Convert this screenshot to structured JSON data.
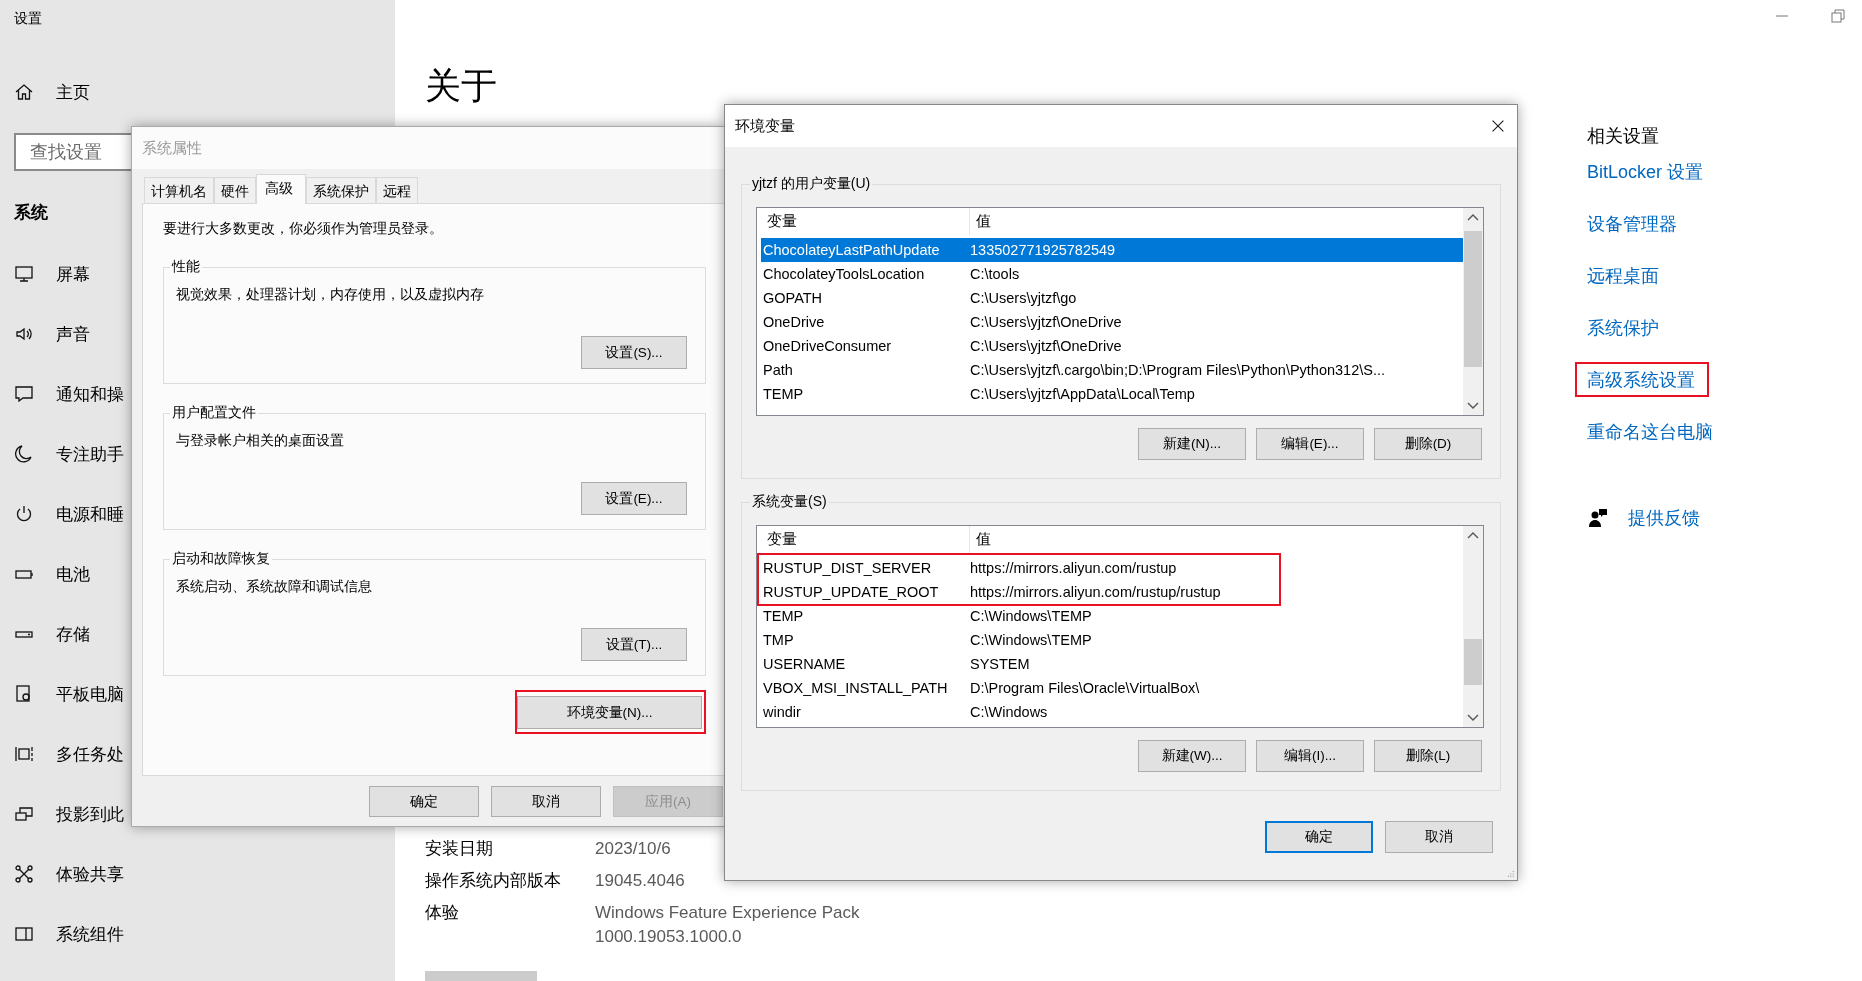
{
  "window": {
    "title": "设置"
  },
  "sidebar": {
    "home": "主页",
    "search": {
      "placeholder": "查找设置"
    },
    "section": "系统",
    "items": [
      {
        "label": "屏幕"
      },
      {
        "label": "声音"
      },
      {
        "label": "通知和操"
      },
      {
        "label": "专注助手"
      },
      {
        "label": "电源和睡"
      },
      {
        "label": "电池"
      },
      {
        "label": "存储"
      },
      {
        "label": "平板电脑"
      },
      {
        "label": "多任务处"
      },
      {
        "label": "投影到此"
      },
      {
        "label": "体验共享"
      },
      {
        "label": "系统组件"
      }
    ]
  },
  "main": {
    "title": "关于",
    "specs": [
      {
        "label": "安装日期",
        "value": "2023/10/6"
      },
      {
        "label": "操作系统内部版本",
        "value": "19045.4046"
      },
      {
        "label": "体验",
        "value": "Windows Feature Experience Pack 1000.19053.1000.0"
      }
    ]
  },
  "related": {
    "title": "相关设置",
    "links": [
      {
        "label": "BitLocker 设置",
        "highlighted": false
      },
      {
        "label": "设备管理器",
        "highlighted": false
      },
      {
        "label": "远程桌面",
        "highlighted": false
      },
      {
        "label": "系统保护",
        "highlighted": false
      },
      {
        "label": "高级系统设置",
        "highlighted": true
      },
      {
        "label": "重命名这台电脑",
        "highlighted": false
      }
    ],
    "feedback": "提供反馈"
  },
  "system_properties": {
    "title": "系统属性",
    "tabs": [
      {
        "label": "计算机名",
        "selected": false
      },
      {
        "label": "硬件",
        "selected": false
      },
      {
        "label": "高级",
        "selected": true
      },
      {
        "label": "系统保护",
        "selected": false
      },
      {
        "label": "远程",
        "selected": false
      }
    ],
    "notice": "要进行大多数更改，你必须作为管理员登录。",
    "groups": [
      {
        "title": "性能",
        "description": "视觉效果，处理器计划，内存使用，以及虚拟内存",
        "button": "设置(S)..."
      },
      {
        "title": "用户配置文件",
        "description": "与登录帐户相关的桌面设置",
        "button": "设置(E)..."
      },
      {
        "title": "启动和故障恢复",
        "description": "系统启动、系统故障和调试信息",
        "button": "设置(T)..."
      }
    ],
    "env_button": {
      "label": "环境变量(N)...",
      "highlighted": true
    },
    "buttons": [
      {
        "label": "确定",
        "disabled": false
      },
      {
        "label": "取消",
        "disabled": false
      },
      {
        "label": "应用(A)",
        "disabled": true
      }
    ]
  },
  "environment": {
    "title": "环境变量",
    "sections": [
      {
        "title": "yjtzf 的用户变量(U)",
        "columns": [
          "变量",
          "值"
        ],
        "rows": [
          {
            "name": "ChocolateyLastPathUpdate",
            "value": "133502771925782549",
            "selected": true,
            "highlighted": false
          },
          {
            "name": "ChocolateyToolsLocation",
            "value": "C:\\tools",
            "selected": false,
            "highlighted": false
          },
          {
            "name": "GOPATH",
            "value": "C:\\Users\\yjtzf\\go",
            "selected": false,
            "highlighted": false
          },
          {
            "name": "OneDrive",
            "value": "C:\\Users\\yjtzf\\OneDrive",
            "selected": false,
            "highlighted": false
          },
          {
            "name": "OneDriveConsumer",
            "value": "C:\\Users\\yjtzf\\OneDrive",
            "selected": false,
            "highlighted": false
          },
          {
            "name": "Path",
            "value": "C:\\Users\\yjtzf\\.cargo\\bin;D:\\Program Files\\Python\\Python312\\S...",
            "selected": false,
            "highlighted": false
          },
          {
            "name": "TEMP",
            "value": "C:\\Users\\yjtzf\\AppData\\Local\\Temp",
            "selected": false,
            "highlighted": false
          }
        ],
        "buttons": [
          "新建(N)...",
          "编辑(E)...",
          "删除(D)"
        ]
      },
      {
        "title": "系统变量(S)",
        "columns": [
          "变量",
          "值"
        ],
        "rows": [
          {
            "name": "RUSTUP_DIST_SERVER",
            "value": "https://mirrors.aliyun.com/rustup",
            "selected": false,
            "highlighted": true
          },
          {
            "name": "RUSTUP_UPDATE_ROOT",
            "value": "https://mirrors.aliyun.com/rustup/rustup",
            "selected": false,
            "highlighted": true
          },
          {
            "name": "TEMP",
            "value": "C:\\Windows\\TEMP",
            "selected": false,
            "highlighted": false
          },
          {
            "name": "TMP",
            "value": "C:\\Windows\\TEMP",
            "selected": false,
            "highlighted": false
          },
          {
            "name": "USERNAME",
            "value": "SYSTEM",
            "selected": false,
            "highlighted": false
          },
          {
            "name": "VBOX_MSI_INSTALL_PATH",
            "value": "D:\\Program Files\\Oracle\\VirtualBox\\",
            "selected": false,
            "highlighted": false
          },
          {
            "name": "windir",
            "value": "C:\\Windows",
            "selected": false,
            "highlighted": false
          }
        ],
        "buttons": [
          "新建(W)...",
          "编辑(I)...",
          "删除(L)"
        ]
      }
    ],
    "buttons": [
      {
        "label": "确定",
        "default": true
      },
      {
        "label": "取消",
        "default": false
      }
    ]
  }
}
